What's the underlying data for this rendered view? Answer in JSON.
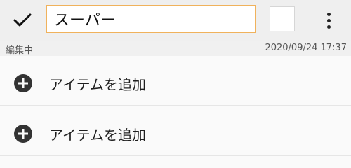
{
  "toolbar": {
    "confirm_icon": "check-icon",
    "title_value": "スーパー",
    "color_swatch": "#ffffff",
    "more_icon": "more-vertical-icon"
  },
  "status": {
    "label": "編集中",
    "timestamp": "2020/09/24 17:37"
  },
  "items": [
    {
      "icon": "plus-circle-icon",
      "label": "アイテムを追加"
    },
    {
      "icon": "plus-circle-icon",
      "label": "アイテムを追加"
    }
  ],
  "colors": {
    "input_border": "#f0b25c",
    "toolbar_bg": "#efefef",
    "icon_dark": "#333333"
  }
}
